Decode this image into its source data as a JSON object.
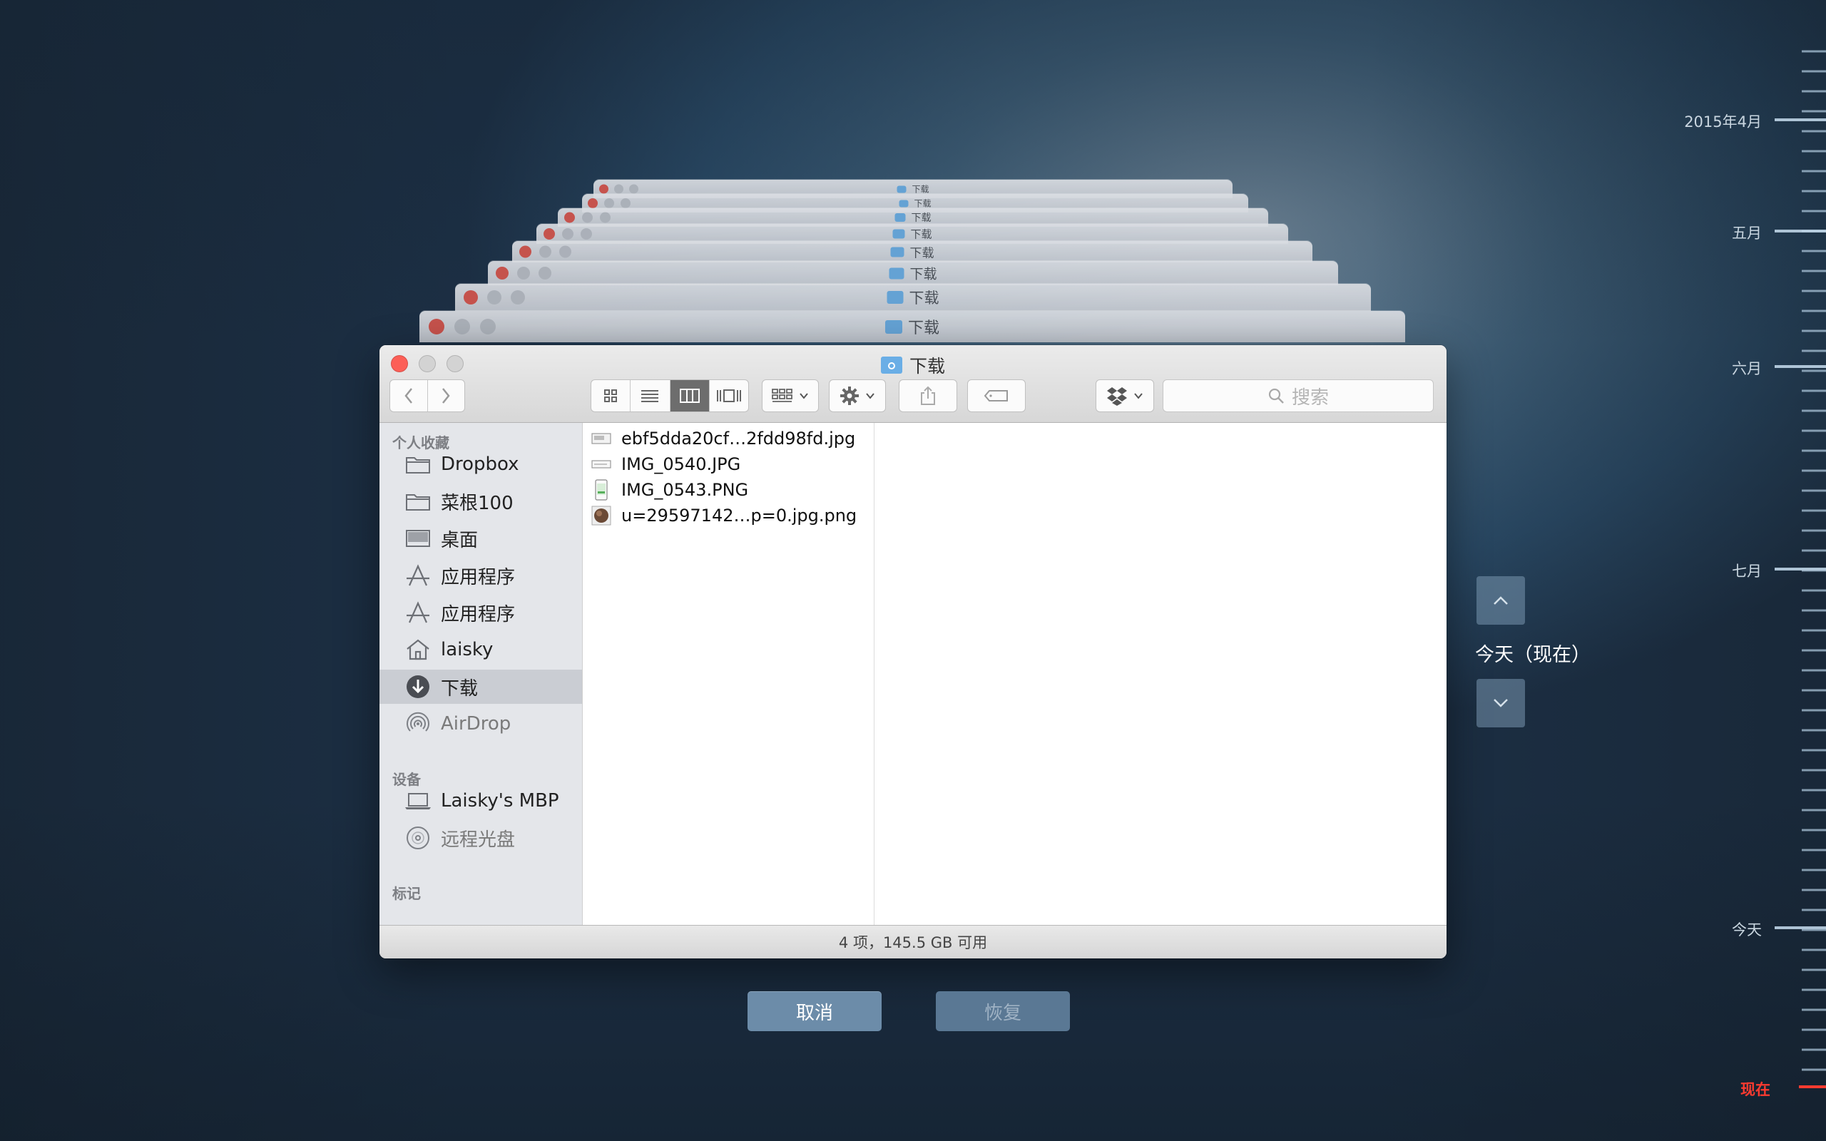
{
  "window": {
    "title": "下载",
    "ghost_title": "下载"
  },
  "toolbar": {
    "back_label": "back",
    "forward_label": "forward",
    "view_modes": [
      "icon-view",
      "list-view",
      "column-view",
      "cover-flow-view"
    ],
    "active_view": "column-view",
    "search_placeholder": "搜索"
  },
  "sidebar": {
    "favorites_header": "个人收藏",
    "favorites": [
      {
        "label": "Dropbox",
        "icon": "folder-icon"
      },
      {
        "label": "菜根100",
        "icon": "folder-icon"
      },
      {
        "label": "桌面",
        "icon": "desktop-icon"
      },
      {
        "label": "应用程序",
        "icon": "applications-icon"
      },
      {
        "label": "应用程序",
        "icon": "applications-icon"
      },
      {
        "label": "laisky",
        "icon": "home-icon"
      },
      {
        "label": "下载",
        "icon": "downloads-icon",
        "selected": true
      },
      {
        "label": "AirDrop",
        "icon": "airdrop-icon"
      }
    ],
    "devices_header": "设备",
    "devices": [
      {
        "label": "Laisky's MBP",
        "icon": "laptop-icon"
      },
      {
        "label": "远程光盘",
        "icon": "disc-icon"
      }
    ],
    "tags_header": "标记"
  },
  "files": [
    {
      "name": "ebf5dda20cf…2fdd98fd.jpg",
      "icon": "image-file-icon"
    },
    {
      "name": "IMG_0540.JPG",
      "icon": "image-file-icon"
    },
    {
      "name": "IMG_0543.PNG",
      "icon": "phone-screenshot-icon"
    },
    {
      "name": "u=29597142…p=0.jpg.png",
      "icon": "photo-thumb-icon"
    }
  ],
  "status": "4 项，145.5 GB 可用",
  "buttons": {
    "cancel": "取消",
    "restore": "恢复"
  },
  "today_label": "今天（现在）",
  "timeline": {
    "labels": [
      "2015年4月",
      "五月",
      "六月",
      "七月",
      "今天",
      "现在"
    ]
  },
  "colors": {
    "accent_now": "#ff3b30",
    "close_button": "#fc5f57",
    "folder_blue": "#6aaee6"
  }
}
